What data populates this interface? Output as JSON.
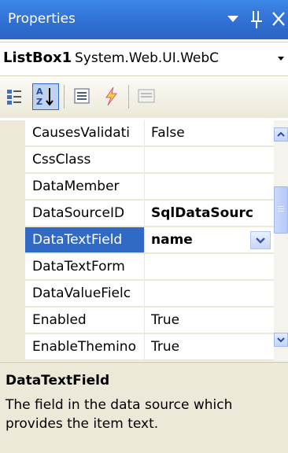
{
  "window": {
    "title": "Properties",
    "menu_glyph": "▼",
    "pin_glyph": "Ѣ",
    "close_glyph": "✕"
  },
  "object_selector": {
    "name": "ListBox1",
    "type": "System.Web.UI.WebC",
    "drop_glyph": "▼"
  },
  "toolbar": {
    "buttons": [
      {
        "name": "categorized",
        "icon": "categorized-icon",
        "active": false
      },
      {
        "name": "alphabetical",
        "icon": "sort-az-icon",
        "active": true
      },
      {
        "name": "properties",
        "icon": "properties-icon",
        "active": false
      },
      {
        "name": "events",
        "icon": "lightning-icon",
        "active": false
      },
      {
        "name": "property-pages",
        "icon": "property-pages-icon",
        "active": false
      }
    ]
  },
  "grid": {
    "rows": [
      {
        "name": "CausesValidati",
        "value": "False"
      },
      {
        "name": "CssClass",
        "value": ""
      },
      {
        "name": "DataMember",
        "value": ""
      },
      {
        "name": "DataSourceID",
        "value": "SqlDataSourc",
        "bold": true
      },
      {
        "name": "DataTextField",
        "value": "name",
        "bold": true,
        "selected": true
      },
      {
        "name": "DataTextForm",
        "value": ""
      },
      {
        "name": "DataValueFielc",
        "value": ""
      },
      {
        "name": "Enabled",
        "value": "True"
      },
      {
        "name": "EnableThemino",
        "value": "True"
      }
    ]
  },
  "description": {
    "title": "DataTextField",
    "text": "The field in the data source which provides the item text."
  },
  "colors": {
    "title_bar": "#2f6fd1",
    "selection": "#316ac5",
    "panel": "#ece9d8"
  }
}
